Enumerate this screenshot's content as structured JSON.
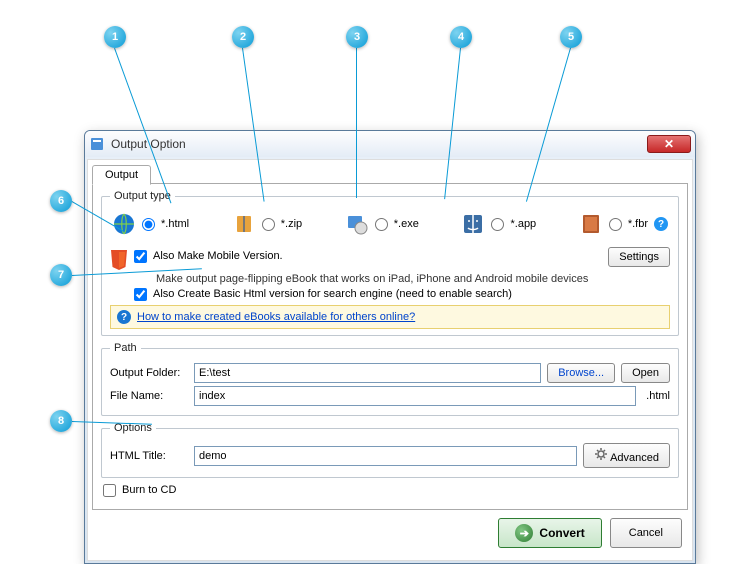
{
  "callouts": [
    "1",
    "2",
    "3",
    "4",
    "5",
    "6",
    "7",
    "8"
  ],
  "window": {
    "title": "Output Option"
  },
  "tab": {
    "label": "Output"
  },
  "outputType": {
    "legend": "Output type",
    "items": [
      {
        "label": "*.html"
      },
      {
        "label": "*.zip"
      },
      {
        "label": "*.exe"
      },
      {
        "label": "*.app"
      },
      {
        "label": "*.fbr"
      }
    ],
    "settings": "Settings"
  },
  "mobile": {
    "label": "Also Make Mobile Version.",
    "desc": "Make output page-flipping eBook that works on iPad, iPhone and Android mobile devices"
  },
  "basicHtml": {
    "label": "Also Create Basic Html version for search engine (need to enable search)"
  },
  "infobar": {
    "link": "How to make created eBooks available for others online?"
  },
  "path": {
    "legend": "Path",
    "folderLabel": "Output Folder:",
    "folderValue": "E:\\test",
    "browse": "Browse...",
    "open": "Open",
    "fileLabel": "File Name:",
    "fileValue": "index",
    "ext": ".html"
  },
  "options": {
    "legend": "Options",
    "titleLabel": "HTML Title:",
    "titleValue": "demo",
    "advanced": "Advanced"
  },
  "burn": {
    "label": "Burn to CD"
  },
  "buttons": {
    "convert": "Convert",
    "cancel": "Cancel"
  }
}
